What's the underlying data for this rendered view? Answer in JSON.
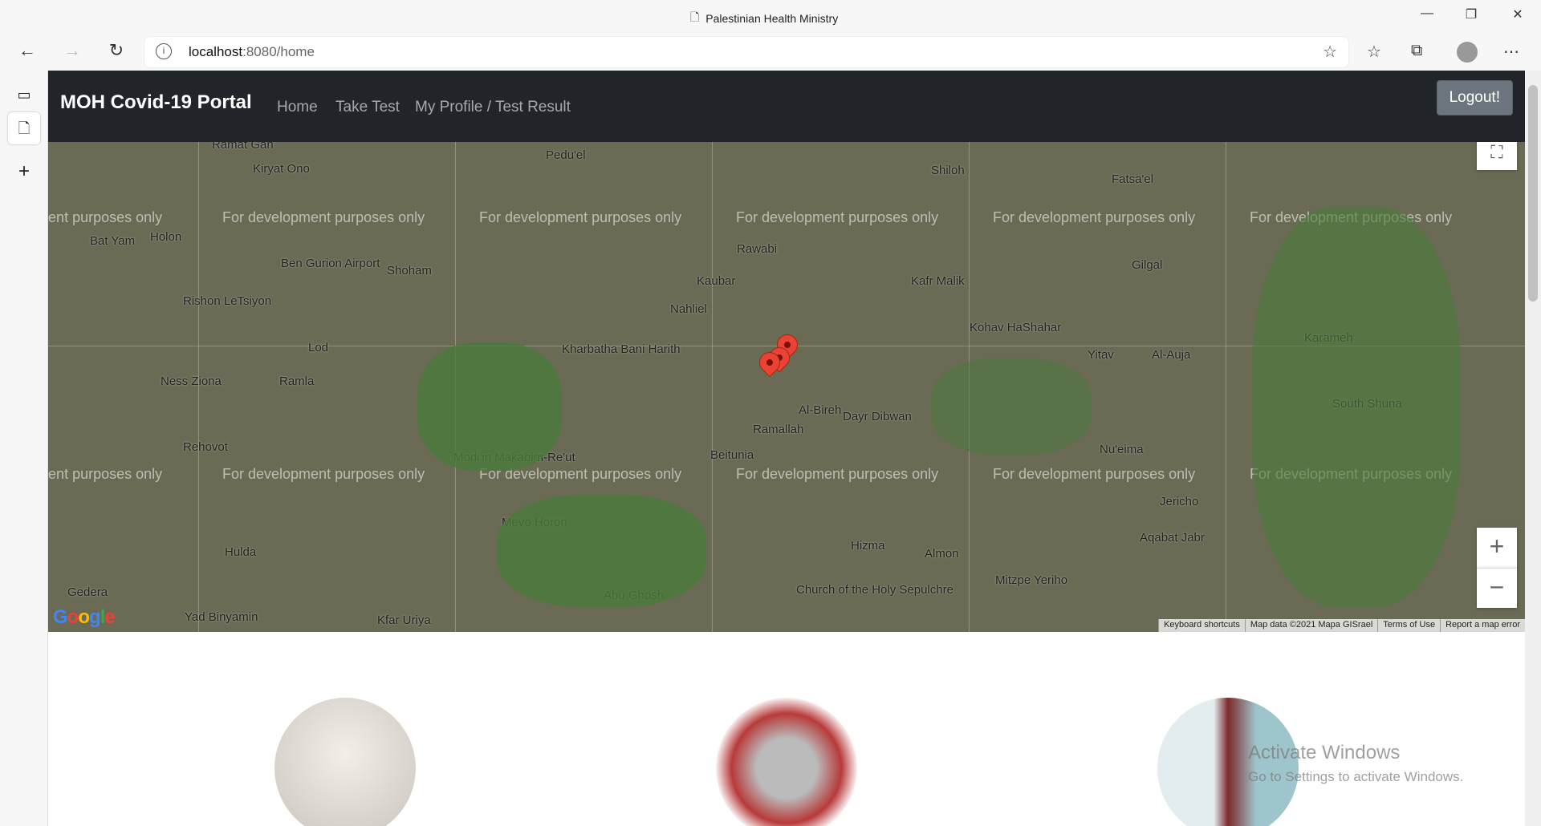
{
  "browser": {
    "window_title": "Palestinian Health Ministry",
    "url_host": "localhost",
    "url_rest": ":8080/home"
  },
  "navbar": {
    "brand": "MOH Covid-19 Portal",
    "links": [
      "Home",
      "Take Test",
      "My Profile / Test Result"
    ],
    "logout": "Logout!"
  },
  "map": {
    "watermark": "For development purposes only",
    "places": [
      "Ramat Gan",
      "Kiryat Ono",
      "Holon",
      "Bat Yam",
      "Ben Gurion Airport",
      "Shoham",
      "Rishon LeTsiyon",
      "Lod",
      "Ramla",
      "Ness Ziona",
      "Rehovot",
      "Modi'in Makabim-Re'ut",
      "Kharbatha Bani Harith",
      "Rawabi",
      "Kaubar",
      "Nahliel",
      "Al-Bireh",
      "Ramallah",
      "Dayr Dibwan",
      "Beitunia",
      "Kafr Malik",
      "Gilgal",
      "Kohav HaShahar",
      "Yitav",
      "Al-Auja",
      "Karameh",
      "South Shuna",
      "Nu'eima",
      "Jericho",
      "Aqabat Jabr",
      "Hizma",
      "Almon",
      "Church of the Holy Sepulchre",
      "Mevo Horon",
      "Abu Ghosh",
      "Hulda",
      "Gedera",
      "Yad Binyamin",
      "Kfar Uriya",
      "Mitzpe Yeriho",
      "Pedu'el",
      "Shiloh",
      "Fatsa'el"
    ],
    "attribution": [
      "Keyboard shortcuts",
      "Map data ©2021 Mapa GISrael",
      "Terms of Use",
      "Report a map error"
    ],
    "logo": "Google",
    "marker_color": "#ea4335"
  },
  "windows_notice": {
    "title": "Activate Windows",
    "subtitle": "Go to Settings to activate Windows."
  }
}
